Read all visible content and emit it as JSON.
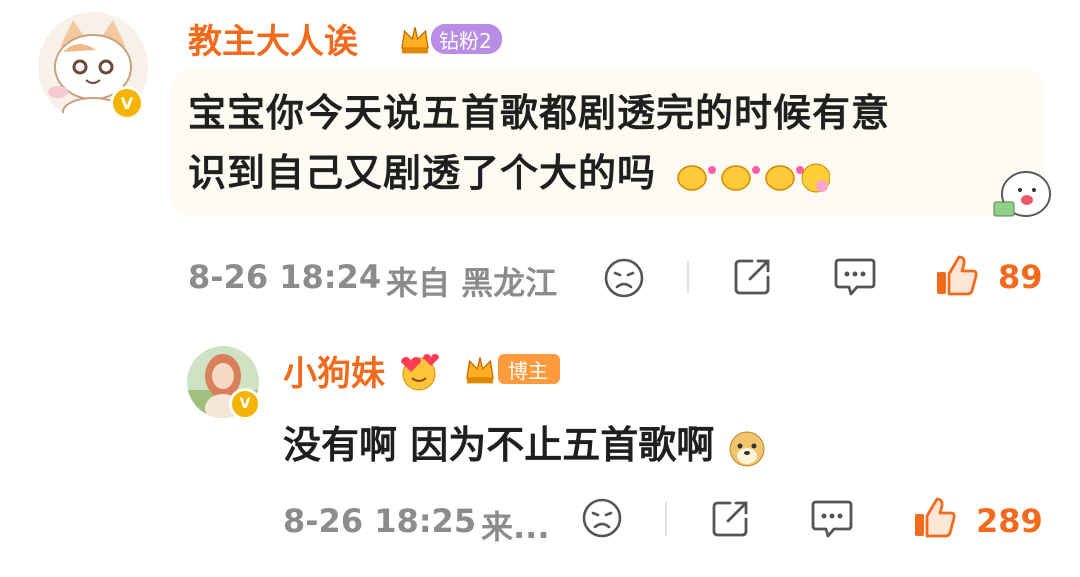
{
  "comment": {
    "username": "教主大人诶",
    "badge_label": "钻粉2",
    "text_line1": "宝宝你今天说五首歌都剧透完的时候有意",
    "text_line2": "识到自己又剧透了个大的吗",
    "date": "8-26 18:24",
    "location": "来自 黑龙江",
    "likes": "89",
    "verified_mark": "V"
  },
  "reply": {
    "username": "小狗妹",
    "badge_label": "博主",
    "text": "没有啊 因为不止五首歌啊",
    "date": "8-26 18:25",
    "location_truncated": "来...",
    "likes": "289",
    "verified_mark": "V"
  },
  "colors": {
    "accent_orange": "#f26b1c",
    "badge_purple": "#b98de6",
    "badge_orange": "#ff9a3d",
    "verified_gold": "#f5b400",
    "meta_gray": "#8c8c8c"
  },
  "icons": [
    "dislike-icon",
    "share-icon",
    "comment-icon",
    "like-icon"
  ]
}
